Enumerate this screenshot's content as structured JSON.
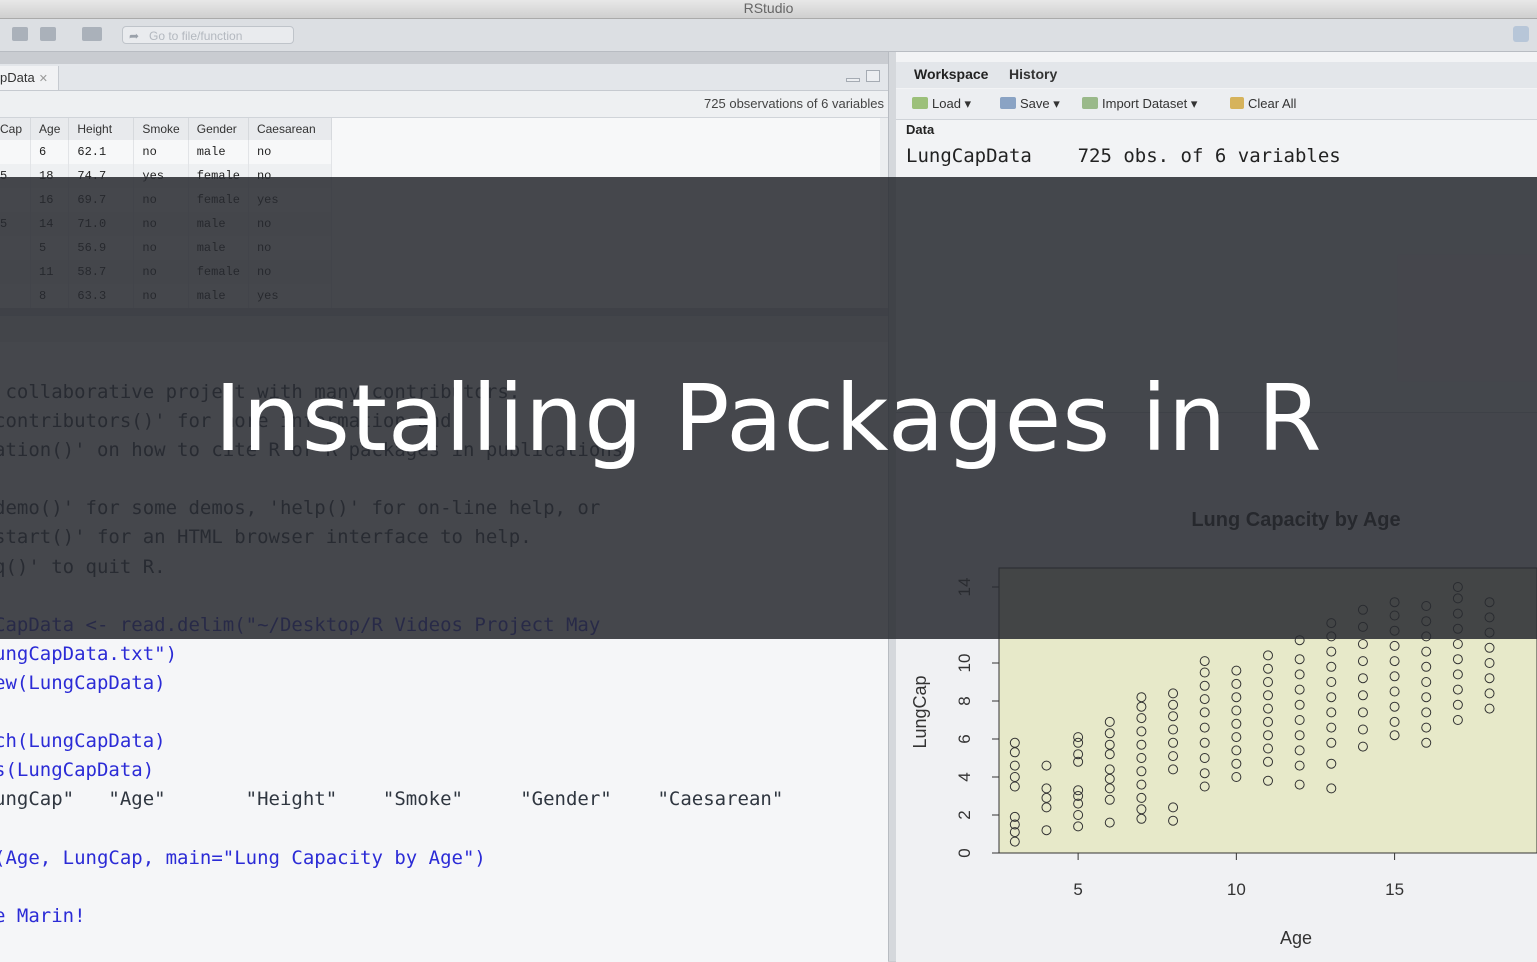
{
  "window": {
    "title": "RStudio"
  },
  "toolbar": {
    "goto_placeholder": "Go to file/function"
  },
  "data_viewer": {
    "tab_label": "pData",
    "summary": "725 observations of 6 variables",
    "columns": [
      "Cap",
      "Age",
      "Height",
      "Smoke",
      "Gender",
      "Caesarean"
    ],
    "rows": [
      [
        "",
        "6",
        "62.1",
        "no",
        "male",
        "no"
      ],
      [
        "5",
        "18",
        "74.7",
        "yes",
        "female",
        "no"
      ],
      [
        "",
        "16",
        "69.7",
        "no",
        "female",
        "yes"
      ],
      [
        "5",
        "14",
        "71.0",
        "no",
        "male",
        "no"
      ],
      [
        "",
        "5",
        "56.9",
        "no",
        "male",
        "no"
      ],
      [
        "",
        "11",
        "58.7",
        "no",
        "female",
        "no"
      ],
      [
        "",
        "8",
        "63.3",
        "no",
        "male",
        "yes"
      ]
    ]
  },
  "console": {
    "lines": [
      {
        "text": " collaborative project with many contributors.",
        "kind": "out"
      },
      {
        "text": "contributors()' for more information and",
        "kind": "out"
      },
      {
        "text": "ation()' on how to cite R or R packages in publications.",
        "kind": "out"
      },
      {
        "text": "",
        "kind": "out"
      },
      {
        "text": "demo()' for some demos, 'help()' for on-line help, or",
        "kind": "out"
      },
      {
        "text": "start()' for an HTML browser interface to help.",
        "kind": "out"
      },
      {
        "text": "q()' to quit R.",
        "kind": "out"
      },
      {
        "text": "",
        "kind": "out"
      },
      {
        "text": "CapData <- read.delim(\"~/Desktop/R Videos Project May",
        "kind": "in"
      },
      {
        "text": "ungCapData.txt\")",
        "kind": "in"
      },
      {
        "text": "ew(LungCapData)",
        "kind": "in"
      },
      {
        "text": "",
        "kind": "in"
      },
      {
        "text": "ch(LungCapData)",
        "kind": "in"
      },
      {
        "text": "s(LungCapData)",
        "kind": "in"
      },
      {
        "text": "ungCap\"   \"Age\"       \"Height\"    \"Smoke\"     \"Gender\"    \"Caesarean\"",
        "kind": "out"
      },
      {
        "text": "",
        "kind": "out"
      },
      {
        "text": "(Age, LungCap, main=\"Lung Capacity by Age\")",
        "kind": "in"
      },
      {
        "text": "",
        "kind": "in"
      },
      {
        "text": "e Marin!",
        "kind": "in"
      }
    ]
  },
  "workspace": {
    "tabs": [
      "Workspace",
      "History"
    ],
    "buttons": [
      "Load",
      "Save",
      "Import Dataset",
      "Clear All"
    ],
    "section": "Data",
    "object_name": "LungCapData",
    "object_desc": "725 obs. of 6 variables"
  },
  "overlay": {
    "title": "Installing Packages in R"
  },
  "chart_data": {
    "type": "scatter",
    "title": "Lung Capacity by Age",
    "xlabel": "Age",
    "ylabel": "LungCap",
    "xlim": [
      2.5,
      19.5
    ],
    "ylim": [
      0,
      15
    ],
    "xticks": [
      5,
      10,
      15
    ],
    "yticks": [
      0,
      2,
      4,
      6,
      8,
      10,
      14
    ],
    "groups": [
      {
        "x": 3,
        "y": [
          0.6,
          1.1,
          1.5,
          1.9,
          3.5,
          4.0,
          4.6,
          5.3,
          5.8
        ]
      },
      {
        "x": 4,
        "y": [
          1.2,
          2.4,
          2.9,
          3.4,
          4.6
        ]
      },
      {
        "x": 5,
        "y": [
          1.4,
          2.0,
          2.6,
          3.0,
          3.3,
          4.8,
          5.2,
          5.8,
          6.1
        ]
      },
      {
        "x": 6,
        "y": [
          1.6,
          2.8,
          3.4,
          3.9,
          4.4,
          5.2,
          5.7,
          6.3,
          6.9
        ]
      },
      {
        "x": 7,
        "y": [
          1.8,
          2.3,
          2.9,
          3.6,
          4.3,
          5.0,
          5.7,
          6.4,
          7.1,
          7.7,
          8.2
        ]
      },
      {
        "x": 8,
        "y": [
          1.7,
          2.4,
          4.4,
          5.1,
          5.8,
          6.5,
          7.2,
          7.8,
          8.4
        ]
      },
      {
        "x": 9,
        "y": [
          3.5,
          4.2,
          5.0,
          5.8,
          6.6,
          7.4,
          8.1,
          8.8,
          9.5,
          10.1
        ]
      },
      {
        "x": 10,
        "y": [
          4.0,
          4.7,
          5.4,
          6.1,
          6.8,
          7.5,
          8.2,
          8.9,
          9.6
        ]
      },
      {
        "x": 11,
        "y": [
          3.8,
          4.8,
          5.5,
          6.2,
          6.9,
          7.6,
          8.3,
          9.0,
          9.7,
          10.4
        ]
      },
      {
        "x": 12,
        "y": [
          3.6,
          4.6,
          5.4,
          6.2,
          7.0,
          7.8,
          8.6,
          9.4,
          10.2,
          11.2
        ]
      },
      {
        "x": 13,
        "y": [
          3.4,
          4.7,
          5.8,
          6.6,
          7.4,
          8.2,
          9.0,
          9.8,
          10.6,
          11.4,
          12.1
        ]
      },
      {
        "x": 14,
        "y": [
          5.6,
          6.5,
          7.4,
          8.3,
          9.2,
          10.1,
          11.0,
          11.9,
          12.8
        ]
      },
      {
        "x": 15,
        "y": [
          6.2,
          6.9,
          7.7,
          8.5,
          9.3,
          10.1,
          10.9,
          11.7,
          12.5,
          13.2
        ]
      },
      {
        "x": 16,
        "y": [
          5.8,
          6.6,
          7.4,
          8.2,
          9.0,
          9.8,
          10.6,
          11.4,
          12.2,
          13.0
        ]
      },
      {
        "x": 17,
        "y": [
          7.0,
          7.8,
          8.6,
          9.4,
          10.2,
          11.0,
          11.8,
          12.6,
          13.4,
          14.0
        ]
      },
      {
        "x": 18,
        "y": [
          7.6,
          8.4,
          9.2,
          10.0,
          10.8,
          11.6,
          12.4,
          13.2
        ]
      }
    ]
  }
}
